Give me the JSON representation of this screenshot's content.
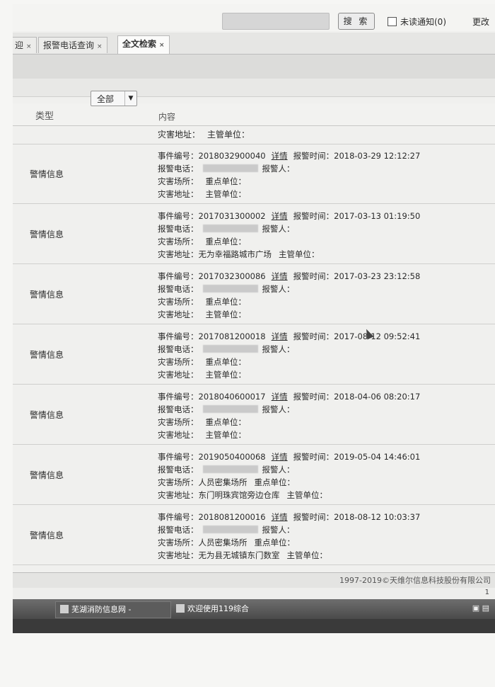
{
  "topbar": {
    "search_button": "搜 索",
    "unread_notice": "未读通知(0)",
    "more_label": "更改"
  },
  "tabs": [
    {
      "label": "迎",
      "close": "×"
    },
    {
      "label": "报警电话查询",
      "close": "×"
    },
    {
      "label": "全文检索",
      "close": "×",
      "active": true
    }
  ],
  "filter": {
    "selected": "全部"
  },
  "table": {
    "col_type": "类型",
    "col_content": "内容",
    "first_row": {
      "addr_label": "灾害地址：",
      "unit_label": "主管单位："
    }
  },
  "labels": {
    "event_no": "事件编号：",
    "detail": "详情",
    "alarm_time": "报警时间：",
    "phone": "报警电话：",
    "reporter": "报警人：",
    "place": "灾害场所：",
    "key_unit": "重点单位：",
    "address": "灾害地址：",
    "mgr_unit": "主管单位："
  },
  "rows": [
    {
      "type": "警情信息",
      "event_no": "2018032900040",
      "time": "2018-03-29 12:12:27",
      "place": "",
      "address": ""
    },
    {
      "type": "警情信息",
      "event_no": "2017031300002",
      "time": "2017-03-13 01:19:50",
      "place": "",
      "address": "无为幸福路城市广场"
    },
    {
      "type": "警情信息",
      "event_no": "2017032300086",
      "time": "2017-03-23 23:12:58",
      "place": "",
      "address": ""
    },
    {
      "type": "警情信息",
      "event_no": "2017081200018",
      "time": "2017-08-12 09:52:41",
      "place": "",
      "address": ""
    },
    {
      "type": "警情信息",
      "event_no": "2018040600017",
      "time": "2018-04-06 08:20:17",
      "place": "",
      "address": ""
    },
    {
      "type": "警情信息",
      "event_no": "2019050400068",
      "time": "2019-05-04 14:46:01",
      "place": "人员密集场所",
      "address": "东门明珠宾馆旁边仓库"
    },
    {
      "type": "警情信息",
      "event_no": "2018081200016",
      "time": "2018-08-12 10:03:37",
      "place": "人员密集场所",
      "address": "无为县无城镇东门数室"
    }
  ],
  "footer": {
    "copyright": "1997-2019©天维尔信息科技股份有限公司"
  },
  "taskbar": {
    "item1": "芜湖消防信息网 -",
    "item2": "欢迎使用119综合",
    "tray": "1"
  }
}
